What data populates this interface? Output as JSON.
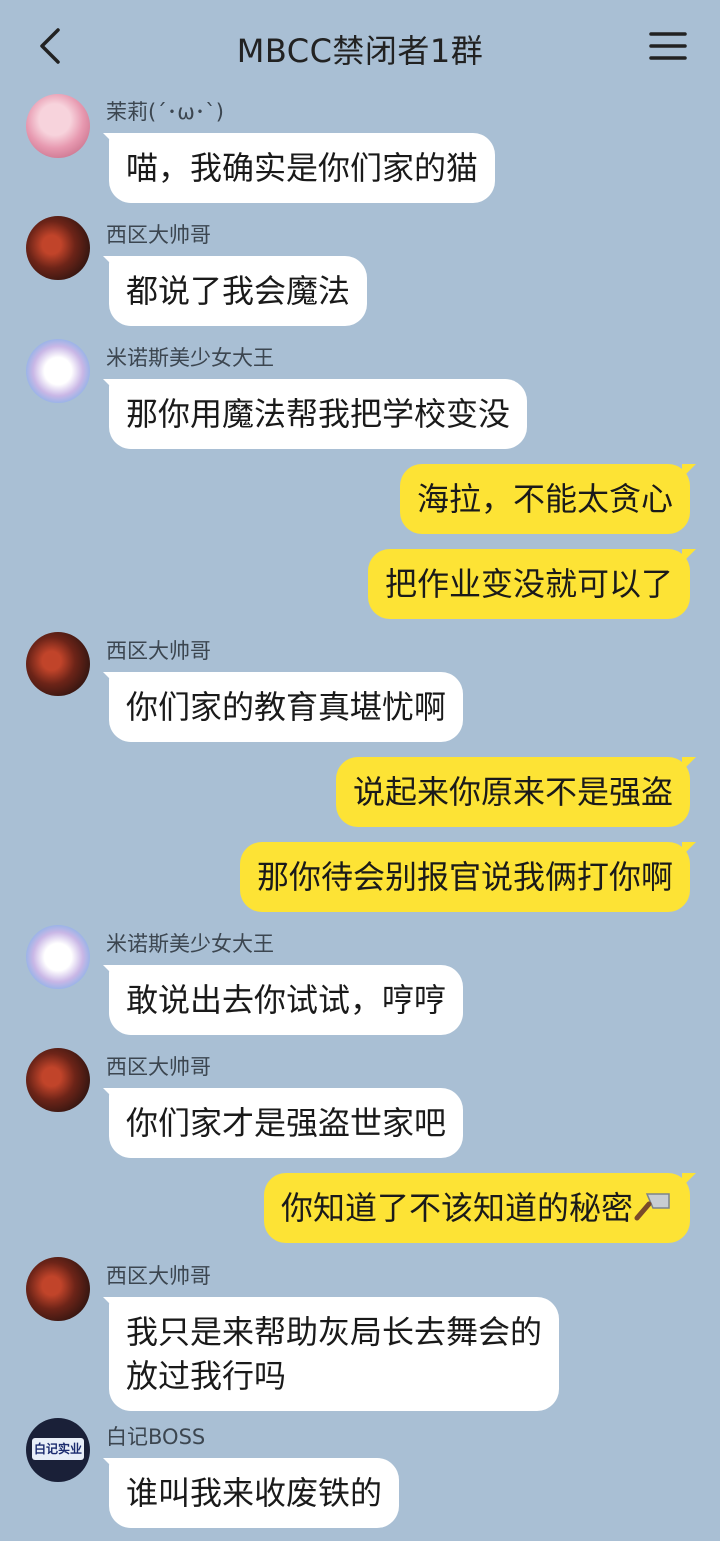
{
  "header": {
    "title": "MBCC禁闭者1群",
    "back_icon": "chevron-left-icon",
    "menu_icon": "hamburger-menu-icon"
  },
  "messages": [
    {
      "side": "in",
      "sender": "茉莉(´･ω･`)",
      "avatar": "moli-avatar",
      "text": "喵，我确实是你们家的猫"
    },
    {
      "side": "in",
      "sender": "西区大帅哥",
      "avatar": "xiqu-avatar",
      "text": "都说了我会魔法"
    },
    {
      "side": "in",
      "sender": "米诺斯美少女大王",
      "avatar": "minos-avatar",
      "text": "那你用魔法帮我把学校变没"
    },
    {
      "side": "out",
      "text": "海拉，不能太贪心"
    },
    {
      "side": "out",
      "text": "把作业变没就可以了"
    },
    {
      "side": "in",
      "sender": "西区大帅哥",
      "avatar": "xiqu-avatar",
      "text": "你们家的教育真堪忧啊"
    },
    {
      "side": "out",
      "text": "说起来你原来不是强盗"
    },
    {
      "side": "out",
      "text": "那你待会别报官说我俩打你啊"
    },
    {
      "side": "in",
      "sender": "米诺斯美少女大王",
      "avatar": "minos-avatar",
      "text": "敢说出去你试试，哼哼"
    },
    {
      "side": "in",
      "sender": "西区大帅哥",
      "avatar": "xiqu-avatar",
      "text": "你们家才是强盗世家吧"
    },
    {
      "side": "out",
      "text": "你知道了不该知道的秘密",
      "emoji": "cleaver-knife-icon"
    },
    {
      "side": "in",
      "sender": "西区大帅哥",
      "avatar": "xiqu-avatar",
      "text_line1": "我只是来帮助灰局长去舞会的",
      "text_line2": "放过我行吗"
    },
    {
      "side": "in",
      "sender": "白记BOSS",
      "avatar": "baiji-avatar",
      "avatar_text": "白记实业",
      "text": "谁叫我来收废铁的"
    }
  ]
}
